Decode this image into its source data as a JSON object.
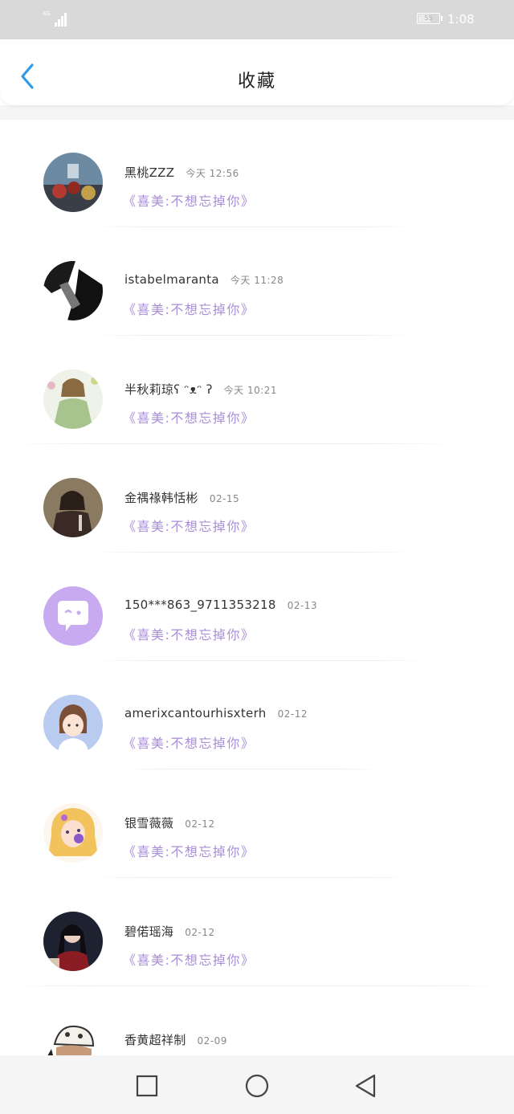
{
  "status_bar": {
    "network": "4G",
    "battery_level": "55",
    "time": "1:08"
  },
  "header": {
    "title": "收藏"
  },
  "items": [
    {
      "name": "黑桃ZZZ",
      "time": "今天 12:56",
      "quote": "《喜美:不想忘掉你》"
    },
    {
      "name": "istabelmaranta",
      "time": "今天 11:28",
      "quote": "《喜美:不想忘掉你》"
    },
    {
      "name": "半秋莉琼ʕ ᵔᴥᵔ ʔ",
      "time": "今天 10:21",
      "quote": "《喜美:不想忘掉你》"
    },
    {
      "name": "金禑禒韩恬彬",
      "time": "02-15",
      "quote": "《喜美:不想忘掉你》"
    },
    {
      "name": "150***863_9711353218",
      "time": "02-13",
      "quote": "《喜美:不想忘掉你》"
    },
    {
      "name": "amerixcantourhisxterh",
      "time": "02-12",
      "quote": "《喜美:不想忘掉你》"
    },
    {
      "name": "银雪薇薇",
      "time": "02-12",
      "quote": "《喜美:不想忘掉你》"
    },
    {
      "name": "碧偌瑶海",
      "time": "02-12",
      "quote": "《喜美:不想忘掉你》"
    },
    {
      "name": "香黄超祥制",
      "time": "02-09",
      "quote": ""
    }
  ],
  "colors": {
    "accent_blue": "#2f9be8",
    "quote_purple": "#a98ed8",
    "status_bar_bg": "#d9d9d9"
  },
  "nav": {
    "recent_icon": "square-icon",
    "home_icon": "circle-icon",
    "back_icon": "triangle-back-icon"
  }
}
